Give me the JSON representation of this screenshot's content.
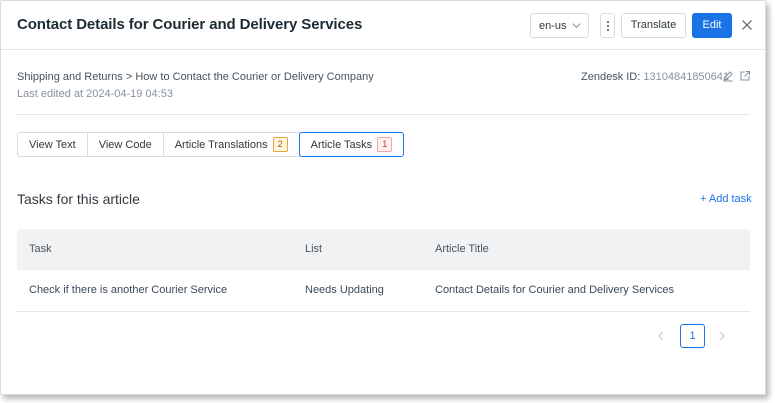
{
  "header": {
    "title": "Contact Details for Courier and Delivery Services",
    "locale": "en-us",
    "translate_label": "Translate",
    "edit_label": "Edit"
  },
  "meta": {
    "breadcrumb": "Shipping and Returns > How to Contact the Courier or Delivery Company",
    "last_edited": "Last edited at 2024-04-19 04:53",
    "zendesk_label": "Zendesk ID:",
    "zendesk_id": "13104841850641"
  },
  "tabs": [
    {
      "label": "View Text"
    },
    {
      "label": "View Code"
    },
    {
      "label": "Article Translations",
      "badge": "2"
    },
    {
      "label": "Article Tasks",
      "badge": "1"
    }
  ],
  "tasks": {
    "title": "Tasks for this article",
    "add_label": "+ Add task",
    "columns": [
      "Task",
      "List",
      "Article Title"
    ],
    "rows": [
      [
        "Check if there is another Courier Service",
        "Needs Updating",
        "Contact Details for Courier and Delivery Services"
      ]
    ]
  },
  "pagination": {
    "current": "1"
  },
  "colors": {
    "accent": "#1b73e8",
    "badge_warning": "#e8a33b",
    "badge_danger": "#cc3340"
  },
  "icons": [
    "chevron-down-icon",
    "kebab-menu-icon",
    "close-icon",
    "pencil-icon",
    "external-link-icon",
    "chevron-left-icon",
    "chevron-right-icon"
  ]
}
